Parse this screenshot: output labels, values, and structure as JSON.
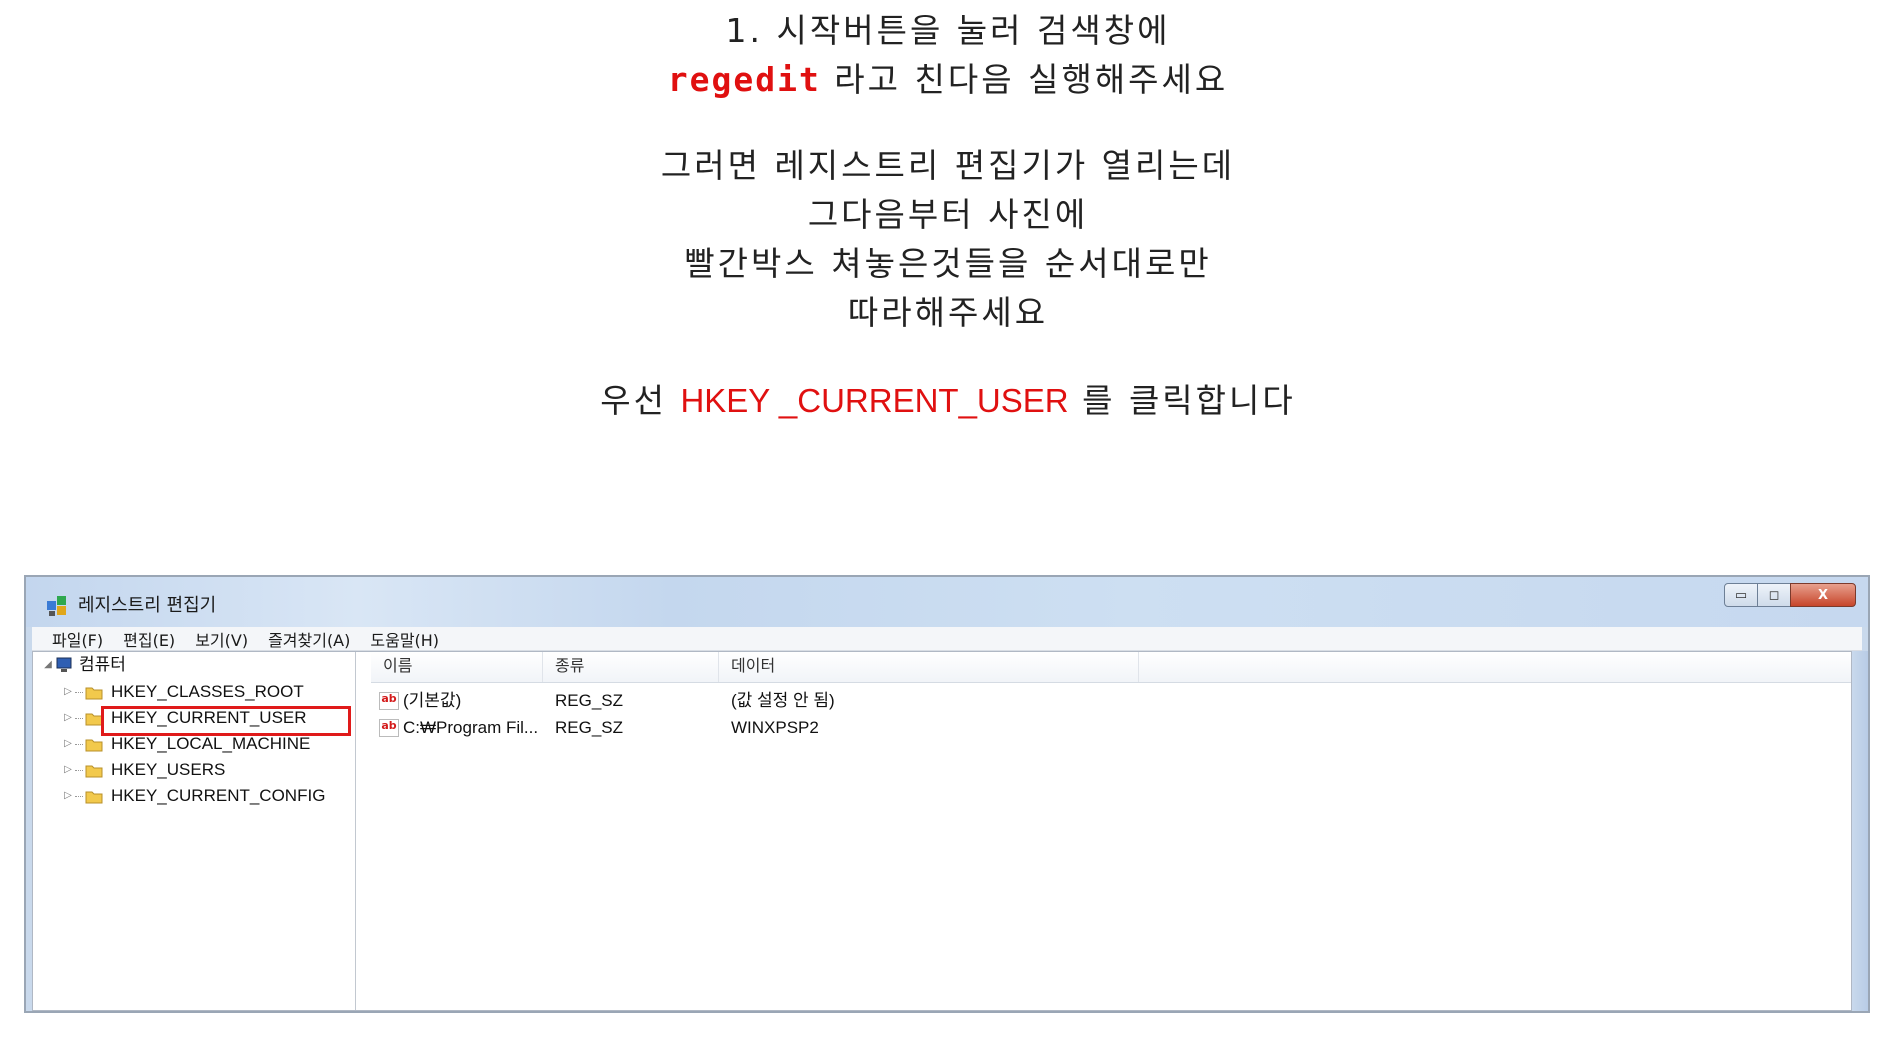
{
  "instructions": {
    "step1_line1": "1. 시작버튼을 눌러 검색창에",
    "step1_cmd": "regedit",
    "step1_line2_rest": " 라고 친다음 실행해주세요",
    "para2_line1": "그러면 레지스트리 편집기가 열리는데",
    "para2_line2": "그다음부터 사진에",
    "para2_line3": "빨간박스 쳐놓은것들을 순서대로만",
    "para2_line4": "따라해주세요",
    "para3_pre": "우선 ",
    "para3_key": "HKEY _CURRENT_USER",
    "para3_post": " 를 클릭합니다",
    "accent_color": "#e01010"
  },
  "window": {
    "title": "레지스트리 편집기",
    "app_icon": "regedit-icon",
    "controls": {
      "minimize_icon": "minimize-icon",
      "maximize_icon": "maximize-icon",
      "close_label": "X"
    },
    "menu": [
      "파일(F)",
      "편집(E)",
      "보기(V)",
      "즐겨찾기(A)",
      "도움말(H)"
    ],
    "tree": {
      "root": "컴퓨터",
      "items": [
        {
          "label": "HKEY_CLASSES_ROOT",
          "expander": "▷",
          "selected": false
        },
        {
          "label": "HKEY_CURRENT_USER",
          "expander": "▷",
          "selected": true
        },
        {
          "label": "HKEY_LOCAL_MACHINE",
          "expander": "▷",
          "selected": false
        },
        {
          "label": "HKEY_USERS",
          "expander": "▷",
          "selected": false
        },
        {
          "label": "HKEY_CURRENT_CONFIG",
          "expander": "▷",
          "selected": false
        }
      ],
      "highlight_color": "#e01a1a"
    },
    "list": {
      "columns": [
        "이름",
        "종류",
        "데이터"
      ],
      "rows": [
        {
          "icon": "string-value-icon",
          "icon_text": "ab",
          "name": "(기본값)",
          "type": "REG_SZ",
          "data": "(값 설정 안 됨)"
        },
        {
          "icon": "string-value-icon",
          "icon_text": "ab",
          "name": "C:₩Program Fil...",
          "type": "REG_SZ",
          "data": "WINXPSP2"
        }
      ]
    }
  }
}
